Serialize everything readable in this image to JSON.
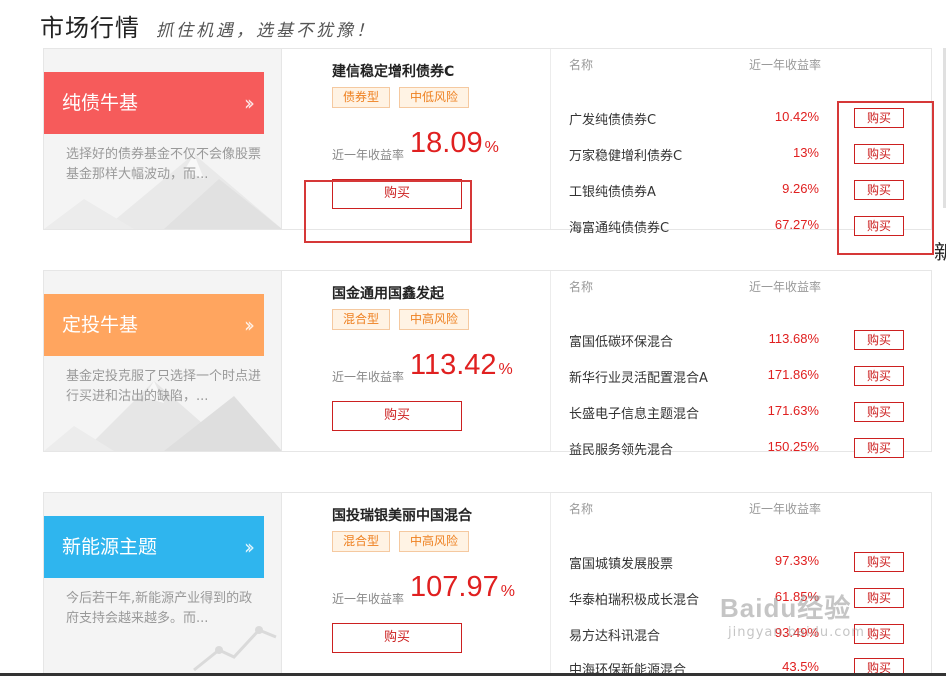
{
  "header": {
    "title": "市场行情",
    "slogan": "抓住机遇，选基不犹豫！"
  },
  "colors": {
    "red": "#f65b5b",
    "orange": "#ffa55f",
    "blue": "#2fb5ee",
    "rate_red": "#e02020",
    "highlight": "#d63838"
  },
  "list_headers": {
    "name": "名称",
    "rate": "近一年收益率"
  },
  "buy_label": "购买",
  "sections": [
    {
      "tag": "纯债牛基",
      "desc": "选择好的债券基金不仅不会像股票基金那样大幅波动，而...",
      "featured": {
        "name": "建信稳定增利债券C",
        "badges": [
          "债券型",
          "中低风险"
        ],
        "rate_label": "近一年收益率",
        "rate": "18.09",
        "unit": "%",
        "buy": "购买"
      },
      "funds": [
        {
          "name": "广发纯债债券C",
          "rate": "10.42%",
          "buy": "购买"
        },
        {
          "name": "万家稳健增利债券C",
          "rate": "13%",
          "buy": "购买"
        },
        {
          "name": "工银纯债债券A",
          "rate": "9.26%",
          "buy": "购买"
        },
        {
          "name": "海富通纯债债券C",
          "rate": "67.27%",
          "buy": "购买"
        }
      ]
    },
    {
      "tag": "定投牛基",
      "desc": "基金定投克服了只选择一个时点进行买进和沽出的缺陷，...",
      "featured": {
        "name": "国金通用国鑫发起",
        "badges": [
          "混合型",
          "中高风险"
        ],
        "rate_label": "近一年收益率",
        "rate": "113.42",
        "unit": "%",
        "buy": "购买"
      },
      "funds": [
        {
          "name": "富国低碳环保混合",
          "rate": "113.68%",
          "buy": "购买"
        },
        {
          "name": "新华行业灵活配置混合A",
          "rate": "171.86%",
          "buy": "购买"
        },
        {
          "name": "长盛电子信息主题混合",
          "rate": "171.63%",
          "buy": "购买"
        },
        {
          "name": "益民服务领先混合",
          "rate": "150.25%",
          "buy": "购买"
        }
      ]
    },
    {
      "tag": "新能源主题",
      "desc": "今后若干年,新能源产业得到的政府支持会越来越多。而...",
      "featured": {
        "name": "国投瑞银美丽中国混合",
        "badges": [
          "混合型",
          "中高风险"
        ],
        "rate_label": "近一年收益率",
        "rate": "107.97",
        "unit": "%",
        "buy": "购买"
      },
      "funds": [
        {
          "name": "富国城镇发展股票",
          "rate": "97.33%",
          "buy": "购买"
        },
        {
          "name": "华泰柏瑞积极成长混合",
          "rate": "61.85%",
          "buy": "购买"
        },
        {
          "name": "易方达科讯混合",
          "rate": "93.49%",
          "buy": "购买"
        },
        {
          "name": "中海环保新能源混合",
          "rate": "43.5%",
          "buy": "购买"
        }
      ]
    }
  ],
  "watermark": {
    "brand": "Baidu经验",
    "url": "jingyan.baidu.com"
  },
  "edge_text": "新"
}
